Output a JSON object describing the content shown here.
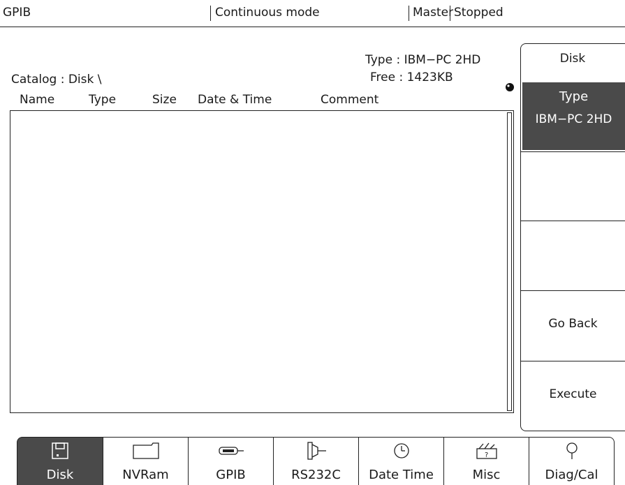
{
  "status_bar": {
    "interface": "GPIB",
    "mode": "Continuous mode",
    "role": "Master",
    "state": "Stopped"
  },
  "catalog": {
    "label": "Catalog : Disk   \\",
    "type_line": "Type : IBM−PC 2HD",
    "free_line": "Free : 1423KB"
  },
  "columns": [
    "Name",
    "Type",
    "Size",
    "Date & Time",
    "Comment"
  ],
  "files": [],
  "softkeys": {
    "title": "Disk",
    "type_label": "Type",
    "type_value": "IBM−PC 2HD",
    "go_back": "Go Back",
    "execute": "Execute"
  },
  "tabs": [
    {
      "label": "Disk",
      "icon": "floppy-disk-icon",
      "active": true
    },
    {
      "label": "NVRam",
      "icon": "folder-icon",
      "active": false
    },
    {
      "label": "GPIB",
      "icon": "gpib-connector-icon",
      "active": false
    },
    {
      "label": "RS232C",
      "icon": "serial-connector-icon",
      "active": false
    },
    {
      "label": "Date Time",
      "icon": "clock-icon",
      "active": false
    },
    {
      "label": "Misc",
      "icon": "toolbox-icon",
      "active": false
    },
    {
      "label": "Diag/Cal",
      "icon": "probe-icon",
      "active": false
    }
  ],
  "colors": {
    "active_fill": "#4a4a4a",
    "line": "#222222",
    "background": "#ffffff"
  }
}
